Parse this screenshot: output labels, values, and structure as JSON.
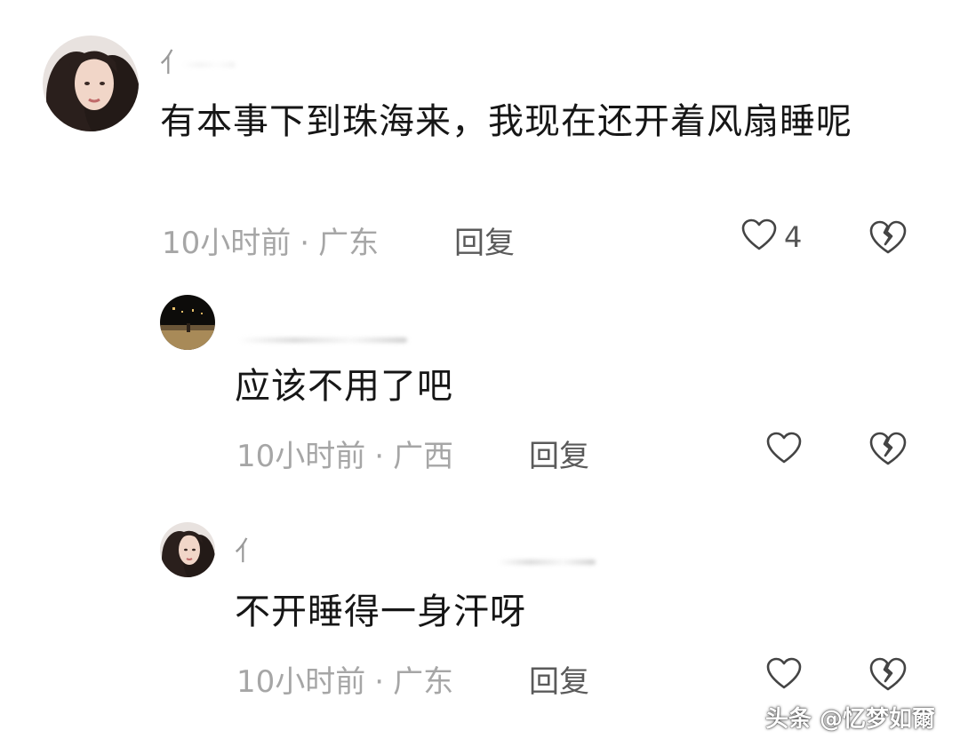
{
  "comments": [
    {
      "username": "亻",
      "content": "有本事下到珠海来，我现在还开着风扇睡呢",
      "time": "10小时前",
      "separator": "·",
      "location": "广东",
      "reply_label": "回复",
      "like_count": "4"
    },
    {
      "username": "",
      "content": "应该不用了吧",
      "time": "10小时前",
      "separator": "·",
      "location": "广西",
      "reply_label": "回复",
      "like_count": ""
    },
    {
      "username": "亻",
      "content": "不开睡得一身汗呀",
      "time": "10小时前",
      "separator": "·",
      "location": "广东",
      "reply_label": "回复",
      "like_count": ""
    }
  ],
  "watermark": "头条 @忆梦如爾",
  "icons": {
    "like": "heart-outline-icon",
    "dislike": "broken-heart-icon"
  },
  "colors": {
    "text_primary": "#161616",
    "text_meta": "#a6a6a6",
    "icon_stroke": "#444444"
  }
}
